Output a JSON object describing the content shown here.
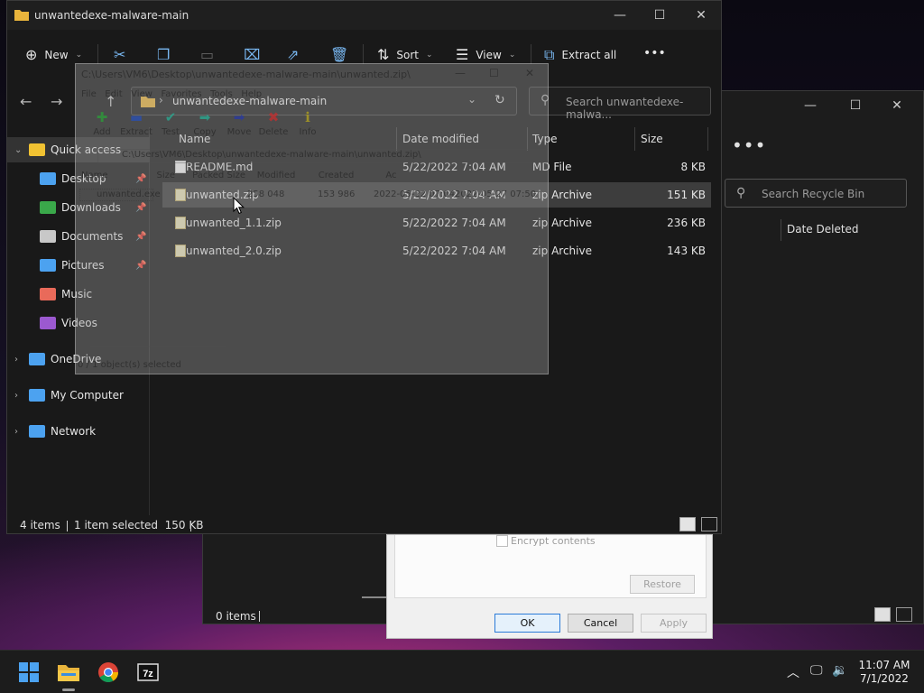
{
  "colors": {
    "accent": "#4ca2f0",
    "folder": "#e9b43c",
    "red": "#e04040",
    "green": "#3aa84a"
  },
  "recycle_bin": {
    "search_placeholder": "Search Recycle Bin",
    "column_date_deleted": "Date Deleted",
    "status_items": "0 items"
  },
  "properties": {
    "encrypt_label": "Encrypt contents",
    "restore_label": "Restore",
    "ok_label": "OK",
    "cancel_label": "Cancel",
    "apply_label": "Apply"
  },
  "explorer": {
    "title": "unwantedexe-malware-main",
    "toolbar": {
      "new_label": "New",
      "sort_label": "Sort",
      "view_label": "View",
      "extract_all_label": "Extract all",
      "more_label": "•••"
    },
    "address": "unwantedexe-malware-main",
    "search_placeholder": "Search unwantedexe-malwa...",
    "nav": [
      {
        "label": "Quick access",
        "icon": "star-icon",
        "chev": "⌄",
        "pin": ""
      },
      {
        "label": "Desktop",
        "icon": "desktop-icon",
        "chev": "",
        "pin": "📌"
      },
      {
        "label": "Downloads",
        "icon": "download-icon",
        "chev": "",
        "pin": "📌"
      },
      {
        "label": "Documents",
        "icon": "document-icon",
        "chev": "",
        "pin": "📌"
      },
      {
        "label": "Pictures",
        "icon": "pictures-icon",
        "chev": "",
        "pin": "📌"
      },
      {
        "label": "Music",
        "icon": "music-icon",
        "chev": "",
        "pin": ""
      },
      {
        "label": "Videos",
        "icon": "videos-icon",
        "chev": "",
        "pin": ""
      },
      {
        "label": "OneDrive",
        "icon": "cloud-icon",
        "chev": "›",
        "pin": ""
      },
      {
        "label": "My Computer",
        "icon": "computer-icon",
        "chev": "›",
        "pin": ""
      },
      {
        "label": "Network",
        "icon": "network-icon",
        "chev": "›",
        "pin": ""
      }
    ],
    "columns": {
      "name": "Name",
      "date": "Date modified",
      "type": "Type",
      "size": "Size"
    },
    "files": [
      {
        "name": "README.md",
        "date": "5/22/2022 7:04 AM",
        "type": "MD File",
        "size": "8 KB"
      },
      {
        "name": "unwanted.zip",
        "date": "5/22/2022 7:04 AM",
        "type": "zip Archive",
        "size": "151 KB"
      },
      {
        "name": "unwanted_1.1.zip",
        "date": "5/22/2022 7:04 AM",
        "type": "zip Archive",
        "size": "236 KB"
      },
      {
        "name": "unwanted_2.0.zip",
        "date": "5/22/2022 7:04 AM",
        "type": "zip Archive",
        "size": "143 KB"
      }
    ],
    "status": {
      "items": "4 items",
      "selected": "1 item selected  150 KB"
    }
  },
  "sevenzip": {
    "title": "C:\\Users\\VM6\\Desktop\\unwantedexe-malware-main\\unwanted.zip\\",
    "menu": "File   Edit   View   Favorites   Tools   Help",
    "tools": [
      "Add",
      "Extract",
      "Test",
      "Copy",
      "Move",
      "Delete",
      "Info"
    ],
    "path": "C:\\Users\\VM6\\Desktop\\unwantedexe-malware-main\\unwanted.zip\\",
    "columns": "Name                 Size      Packed Size    Modified        Created           Ac",
    "row_name": "unwanted.exe",
    "row_size": "258 048",
    "row_packed": "153 986",
    "row_modified": "2022-05-22 07:04",
    "row_created": "2022-05-27 07:50",
    "status": "0 / 1 object(s) selected"
  },
  "taskbar": {
    "time": "11:07 AM",
    "date": "7/1/2022"
  }
}
